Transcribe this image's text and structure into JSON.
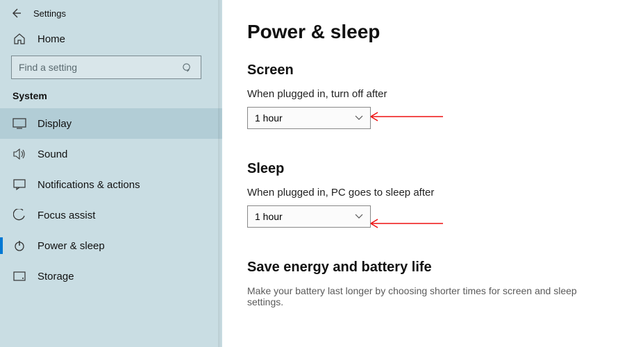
{
  "header": {
    "title": "Settings"
  },
  "sidebar": {
    "home_label": "Home",
    "search_placeholder": "Find a setting",
    "category": "System",
    "items": [
      {
        "label": "Display"
      },
      {
        "label": "Sound"
      },
      {
        "label": "Notifications & actions"
      },
      {
        "label": "Focus assist"
      },
      {
        "label": "Power & sleep"
      },
      {
        "label": "Storage"
      }
    ]
  },
  "main": {
    "page_title": "Power & sleep",
    "screen_section": "Screen",
    "screen_label": "When plugged in, turn off after",
    "screen_value": "1 hour",
    "sleep_section": "Sleep",
    "sleep_label": "When plugged in, PC goes to sleep after",
    "sleep_value": "1 hour",
    "save_section": "Save energy and battery life",
    "save_desc": "Make your battery last longer by choosing shorter times for screen and sleep settings."
  }
}
